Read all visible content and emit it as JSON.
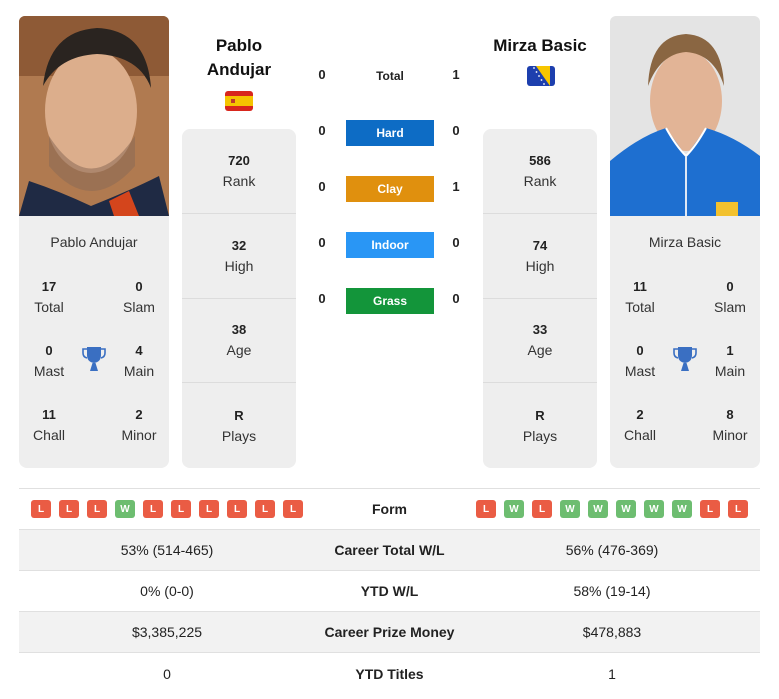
{
  "colors": {
    "hard": "#0d6cc5",
    "clay": "#e0900e",
    "indoor": "#2996f5",
    "grass": "#13953a",
    "win": "#6dbd70",
    "loss": "#ea5c44",
    "trophy": "#3a6fc2"
  },
  "player1": {
    "name_line1": "Pablo",
    "name_line2": "Andujar",
    "card_name": "Pablo Andujar",
    "flag": "spain-flag",
    "rank": "720",
    "rank_label": "Rank",
    "high": "32",
    "high_label": "High",
    "age": "38",
    "age_label": "Age",
    "plays": "R",
    "plays_label": "Plays",
    "titles": {
      "total": "17",
      "total_label": "Total",
      "slam": "0",
      "slam_label": "Slam",
      "mast": "0",
      "mast_label": "Mast",
      "main": "4",
      "main_label": "Main",
      "chall": "11",
      "chall_label": "Chall",
      "minor": "2",
      "minor_label": "Minor"
    },
    "form": [
      "L",
      "L",
      "L",
      "W",
      "L",
      "L",
      "L",
      "L",
      "L",
      "L"
    ],
    "career_wl": "53% (514-465)",
    "ytd_wl": "0% (0-0)",
    "prize_money": "$3,385,225",
    "ytd_titles": "0"
  },
  "player2": {
    "name": "Mirza Basic",
    "card_name": "Mirza Basic",
    "flag": "bosnia-flag",
    "rank": "586",
    "rank_label": "Rank",
    "high": "74",
    "high_label": "High",
    "age": "33",
    "age_label": "Age",
    "plays": "R",
    "plays_label": "Plays",
    "titles": {
      "total": "11",
      "total_label": "Total",
      "slam": "0",
      "slam_label": "Slam",
      "mast": "0",
      "mast_label": "Mast",
      "main": "1",
      "main_label": "Main",
      "chall": "2",
      "chall_label": "Chall",
      "minor": "8",
      "minor_label": "Minor"
    },
    "form": [
      "L",
      "W",
      "L",
      "W",
      "W",
      "W",
      "W",
      "W",
      "L",
      "L"
    ],
    "career_wl": "56% (476-369)",
    "ytd_wl": "58% (19-14)",
    "prize_money": "$478,883",
    "ytd_titles": "1"
  },
  "h2h": {
    "total": {
      "label": "Total",
      "p1": "0",
      "p2": "1"
    },
    "surfaces": [
      {
        "label": "Hard",
        "p1": "0",
        "p2": "0"
      },
      {
        "label": "Clay",
        "p1": "0",
        "p2": "1"
      },
      {
        "label": "Indoor",
        "p1": "0",
        "p2": "0"
      },
      {
        "label": "Grass",
        "p1": "0",
        "p2": "0"
      }
    ]
  },
  "table": {
    "form_label": "Form",
    "career_wl_label": "Career Total W/L",
    "ytd_wl_label": "YTD W/L",
    "prize_money_label": "Career Prize Money",
    "ytd_titles_label": "YTD Titles"
  }
}
